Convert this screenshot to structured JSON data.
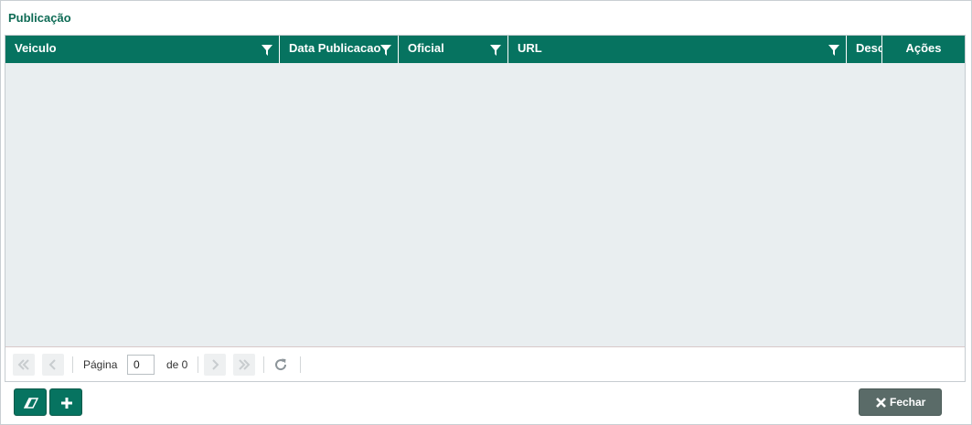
{
  "window": {
    "title": "Publicação"
  },
  "grid": {
    "columns": [
      {
        "label": "Veiculo",
        "filter": true
      },
      {
        "label": "Data Publicacao",
        "filter": true
      },
      {
        "label": "Oficial",
        "filter": true
      },
      {
        "label": "URL",
        "filter": true
      },
      {
        "label": "Desc",
        "filter": false
      },
      {
        "label": "Ações",
        "filter": false
      }
    ],
    "rows": []
  },
  "pager": {
    "page_label": "Página",
    "page_value": "0",
    "of_label": "de 0"
  },
  "footer": {
    "clear_icon": "eraser-icon",
    "add_icon": "plus-icon",
    "close_label": "Fechar"
  },
  "colors": {
    "header_bg": "#067360",
    "title": "#0e6b55",
    "grid_bg": "#e9eef0",
    "close_btn": "#5a6b68"
  }
}
